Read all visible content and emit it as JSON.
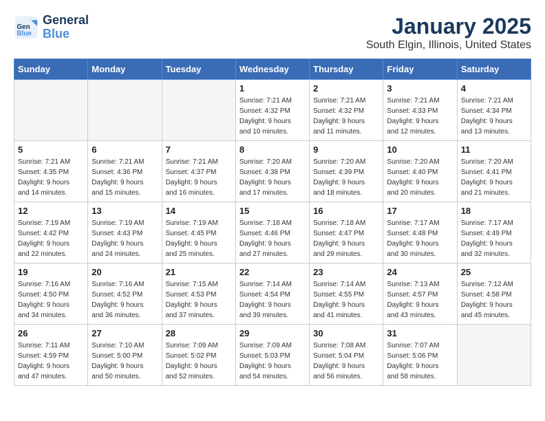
{
  "header": {
    "logo_line1": "General",
    "logo_line2": "Blue",
    "title": "January 2025",
    "subtitle": "South Elgin, Illinois, United States"
  },
  "days_of_week": [
    "Sunday",
    "Monday",
    "Tuesday",
    "Wednesday",
    "Thursday",
    "Friday",
    "Saturday"
  ],
  "weeks": [
    [
      {
        "day": "",
        "info": ""
      },
      {
        "day": "",
        "info": ""
      },
      {
        "day": "",
        "info": ""
      },
      {
        "day": "1",
        "info": "Sunrise: 7:21 AM\nSunset: 4:32 PM\nDaylight: 9 hours\nand 10 minutes."
      },
      {
        "day": "2",
        "info": "Sunrise: 7:21 AM\nSunset: 4:32 PM\nDaylight: 9 hours\nand 11 minutes."
      },
      {
        "day": "3",
        "info": "Sunrise: 7:21 AM\nSunset: 4:33 PM\nDaylight: 9 hours\nand 12 minutes."
      },
      {
        "day": "4",
        "info": "Sunrise: 7:21 AM\nSunset: 4:34 PM\nDaylight: 9 hours\nand 13 minutes."
      }
    ],
    [
      {
        "day": "5",
        "info": "Sunrise: 7:21 AM\nSunset: 4:35 PM\nDaylight: 9 hours\nand 14 minutes."
      },
      {
        "day": "6",
        "info": "Sunrise: 7:21 AM\nSunset: 4:36 PM\nDaylight: 9 hours\nand 15 minutes."
      },
      {
        "day": "7",
        "info": "Sunrise: 7:21 AM\nSunset: 4:37 PM\nDaylight: 9 hours\nand 16 minutes."
      },
      {
        "day": "8",
        "info": "Sunrise: 7:20 AM\nSunset: 4:38 PM\nDaylight: 9 hours\nand 17 minutes."
      },
      {
        "day": "9",
        "info": "Sunrise: 7:20 AM\nSunset: 4:39 PM\nDaylight: 9 hours\nand 18 minutes."
      },
      {
        "day": "10",
        "info": "Sunrise: 7:20 AM\nSunset: 4:40 PM\nDaylight: 9 hours\nand 20 minutes."
      },
      {
        "day": "11",
        "info": "Sunrise: 7:20 AM\nSunset: 4:41 PM\nDaylight: 9 hours\nand 21 minutes."
      }
    ],
    [
      {
        "day": "12",
        "info": "Sunrise: 7:19 AM\nSunset: 4:42 PM\nDaylight: 9 hours\nand 22 minutes."
      },
      {
        "day": "13",
        "info": "Sunrise: 7:19 AM\nSunset: 4:43 PM\nDaylight: 9 hours\nand 24 minutes."
      },
      {
        "day": "14",
        "info": "Sunrise: 7:19 AM\nSunset: 4:45 PM\nDaylight: 9 hours\nand 25 minutes."
      },
      {
        "day": "15",
        "info": "Sunrise: 7:18 AM\nSunset: 4:46 PM\nDaylight: 9 hours\nand 27 minutes."
      },
      {
        "day": "16",
        "info": "Sunrise: 7:18 AM\nSunset: 4:47 PM\nDaylight: 9 hours\nand 29 minutes."
      },
      {
        "day": "17",
        "info": "Sunrise: 7:17 AM\nSunset: 4:48 PM\nDaylight: 9 hours\nand 30 minutes."
      },
      {
        "day": "18",
        "info": "Sunrise: 7:17 AM\nSunset: 4:49 PM\nDaylight: 9 hours\nand 32 minutes."
      }
    ],
    [
      {
        "day": "19",
        "info": "Sunrise: 7:16 AM\nSunset: 4:50 PM\nDaylight: 9 hours\nand 34 minutes."
      },
      {
        "day": "20",
        "info": "Sunrise: 7:16 AM\nSunset: 4:52 PM\nDaylight: 9 hours\nand 36 minutes."
      },
      {
        "day": "21",
        "info": "Sunrise: 7:15 AM\nSunset: 4:53 PM\nDaylight: 9 hours\nand 37 minutes."
      },
      {
        "day": "22",
        "info": "Sunrise: 7:14 AM\nSunset: 4:54 PM\nDaylight: 9 hours\nand 39 minutes."
      },
      {
        "day": "23",
        "info": "Sunrise: 7:14 AM\nSunset: 4:55 PM\nDaylight: 9 hours\nand 41 minutes."
      },
      {
        "day": "24",
        "info": "Sunrise: 7:13 AM\nSunset: 4:57 PM\nDaylight: 9 hours\nand 43 minutes."
      },
      {
        "day": "25",
        "info": "Sunrise: 7:12 AM\nSunset: 4:58 PM\nDaylight: 9 hours\nand 45 minutes."
      }
    ],
    [
      {
        "day": "26",
        "info": "Sunrise: 7:11 AM\nSunset: 4:59 PM\nDaylight: 9 hours\nand 47 minutes."
      },
      {
        "day": "27",
        "info": "Sunrise: 7:10 AM\nSunset: 5:00 PM\nDaylight: 9 hours\nand 50 minutes."
      },
      {
        "day": "28",
        "info": "Sunrise: 7:09 AM\nSunset: 5:02 PM\nDaylight: 9 hours\nand 52 minutes."
      },
      {
        "day": "29",
        "info": "Sunrise: 7:09 AM\nSunset: 5:03 PM\nDaylight: 9 hours\nand 54 minutes."
      },
      {
        "day": "30",
        "info": "Sunrise: 7:08 AM\nSunset: 5:04 PM\nDaylight: 9 hours\nand 56 minutes."
      },
      {
        "day": "31",
        "info": "Sunrise: 7:07 AM\nSunset: 5:06 PM\nDaylight: 9 hours\nand 58 minutes."
      },
      {
        "day": "",
        "info": ""
      }
    ]
  ]
}
